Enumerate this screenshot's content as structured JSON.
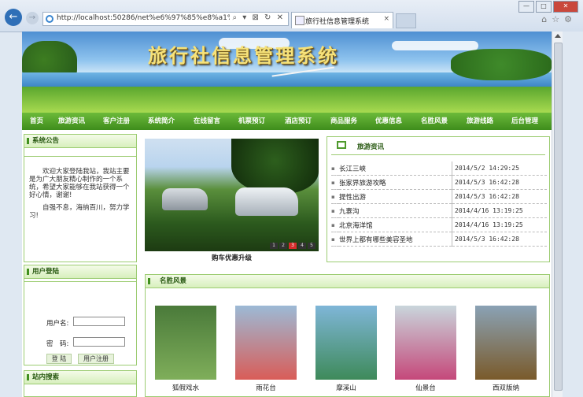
{
  "browser": {
    "url": "http://localhost:50286/net%e6%97%85%e8%a1%8c%",
    "tab_title": "旅行社信息管理系统",
    "tab_close": "×",
    "back_icon": "back-arrow-icon",
    "forward_icon": "forward-arrow-icon",
    "window_buttons": [
      "—",
      "□",
      "✕"
    ],
    "address_tools": "⌕ ▾ ⊠ ↻ ✕"
  },
  "site": {
    "title": "旅行社信息管理系统"
  },
  "nav": [
    "首页",
    "旅游资讯",
    "客户注册",
    "系统简介",
    "在线留言",
    "机票预订",
    "酒店预订",
    "商品服务",
    "优惠信息",
    "名胜风景",
    "旅游线路",
    "后台管理"
  ],
  "notice": {
    "heading": "系统公告",
    "para1": "欢迎大家登陆我站，我站主要是为广大朋友精心制作的一个系统，希望大家能够在我站获得一个好心情，谢谢!",
    "para2": "自强不息，海纳百川，努力学习!"
  },
  "login": {
    "heading": "用户登陆",
    "username_label": "用户名:",
    "password_label": "密　码:",
    "login_button": "登 陆",
    "register_button": "用户注册"
  },
  "search": {
    "heading": "站内搜索"
  },
  "slider": {
    "caption": "购车优惠升级",
    "pages": [
      "1",
      "2",
      "3",
      "4",
      "5"
    ],
    "active_page": 3
  },
  "news": {
    "heading": "旅游资讯",
    "items": [
      {
        "title": "长江三峡",
        "date": "2014/5/2 14:29:25"
      },
      {
        "title": "张家界旅游攻略",
        "date": "2014/5/3 16:42:28"
      },
      {
        "title": "提性出游",
        "date": "2014/5/3 16:42:28"
      },
      {
        "title": "九寨沟",
        "date": "2014/4/16 13:19:25"
      },
      {
        "title": "北京海洋馆",
        "date": "2014/4/16 13:19:25"
      },
      {
        "title": "世界上都有哪些美容圣地",
        "date": "2014/5/3 16:42:28"
      }
    ]
  },
  "scenery": {
    "heading": "名胜风景",
    "items": [
      {
        "name": "狐假戏水",
        "colors": [
          "#4a7a3a",
          "#7fae5a"
        ]
      },
      {
        "name": "雨花台",
        "colors": [
          "#9cbad6",
          "#d95d58"
        ]
      },
      {
        "name": "摩溪山",
        "colors": [
          "#7fb6d8",
          "#3e8a5a"
        ]
      },
      {
        "name": "仙景台",
        "colors": [
          "#c9d6dc",
          "#c5487a"
        ]
      },
      {
        "name": "西双版纳",
        "colors": [
          "#8aa2b5",
          "#7a5a2a"
        ]
      }
    ]
  }
}
